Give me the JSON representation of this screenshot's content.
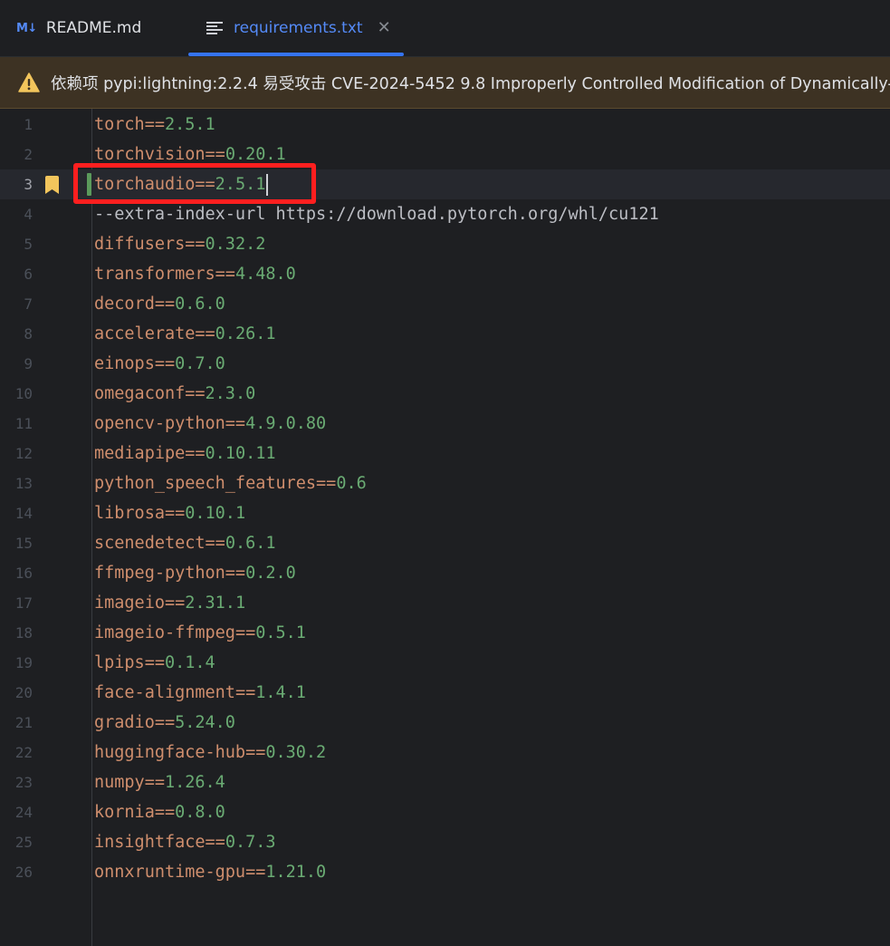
{
  "tabs": [
    {
      "label": "README.md",
      "icon": "markdown-icon",
      "icon_text": "M↓",
      "active": false
    },
    {
      "label": "requirements.txt",
      "icon": "text-file-icon",
      "active": true
    }
  ],
  "banner": {
    "icon": "warning-icon",
    "text": "依赖项 pypi:lightning:2.2.4 易受攻击 CVE-2024-5452 9.8 Improperly Controlled Modification of Dynamically-"
  },
  "editor": {
    "current_line": 3,
    "lines": [
      {
        "n": "1",
        "pkg": "torch",
        "op": "==",
        "ver": "2.5.1"
      },
      {
        "n": "2",
        "pkg": "torchvision",
        "op": "==",
        "ver": "0.20.1"
      },
      {
        "n": "3",
        "pkg": "torchaudio",
        "op": "==",
        "ver": "2.5.1"
      },
      {
        "n": "4",
        "opt": "--extra-index-url",
        "url": " https://download.pytorch.org/whl/cu121"
      },
      {
        "n": "5",
        "pkg": "diffusers",
        "op": "==",
        "ver": "0.32.2"
      },
      {
        "n": "6",
        "pkg": "transformers",
        "op": "==",
        "ver": "4.48.0"
      },
      {
        "n": "7",
        "pkg": "decord",
        "op": "==",
        "ver": "0.6.0"
      },
      {
        "n": "8",
        "pkg": "accelerate",
        "op": "==",
        "ver": "0.26.1"
      },
      {
        "n": "9",
        "pkg": "einops",
        "op": "==",
        "ver": "0.7.0"
      },
      {
        "n": "10",
        "pkg": "omegaconf",
        "op": "==",
        "ver": "2.3.0"
      },
      {
        "n": "11",
        "pkg": "opencv-python",
        "op": "==",
        "ver": "4.9.0.80"
      },
      {
        "n": "12",
        "pkg": "mediapipe",
        "op": "==",
        "ver": "0.10.11"
      },
      {
        "n": "13",
        "pkg": "python_speech_features",
        "op": "==",
        "ver": "0.6"
      },
      {
        "n": "14",
        "pkg": "librosa",
        "op": "==",
        "ver": "0.10.1"
      },
      {
        "n": "15",
        "pkg": "scenedetect",
        "op": "==",
        "ver": "0.6.1"
      },
      {
        "n": "16",
        "pkg": "ffmpeg-python",
        "op": "==",
        "ver": "0.2.0"
      },
      {
        "n": "17",
        "pkg": "imageio",
        "op": "==",
        "ver": "2.31.1"
      },
      {
        "n": "18",
        "pkg": "imageio-ffmpeg",
        "op": "==",
        "ver": "0.5.1"
      },
      {
        "n": "19",
        "pkg": "lpips",
        "op": "==",
        "ver": "0.1.4"
      },
      {
        "n": "20",
        "pkg": "face-alignment",
        "op": "==",
        "ver": "1.4.1"
      },
      {
        "n": "21",
        "pkg": "gradio",
        "op": "==",
        "ver": "5.24.0"
      },
      {
        "n": "22",
        "pkg": "huggingface-hub",
        "op": "==",
        "ver": "0.30.2"
      },
      {
        "n": "23",
        "pkg": "numpy",
        "op": "==",
        "ver": "1.26.4"
      },
      {
        "n": "24",
        "pkg": "kornia",
        "op": "==",
        "ver": "0.8.0"
      },
      {
        "n": "25",
        "pkg": "insightface",
        "op": "==",
        "ver": "0.7.3"
      },
      {
        "n": "26",
        "pkg": "onnxruntime-gpu",
        "op": "==",
        "ver": "1.21.0"
      }
    ]
  },
  "colors": {
    "accent": "#3574f0",
    "warning": "#f2c55c",
    "annotation": "#ff1f1f"
  }
}
